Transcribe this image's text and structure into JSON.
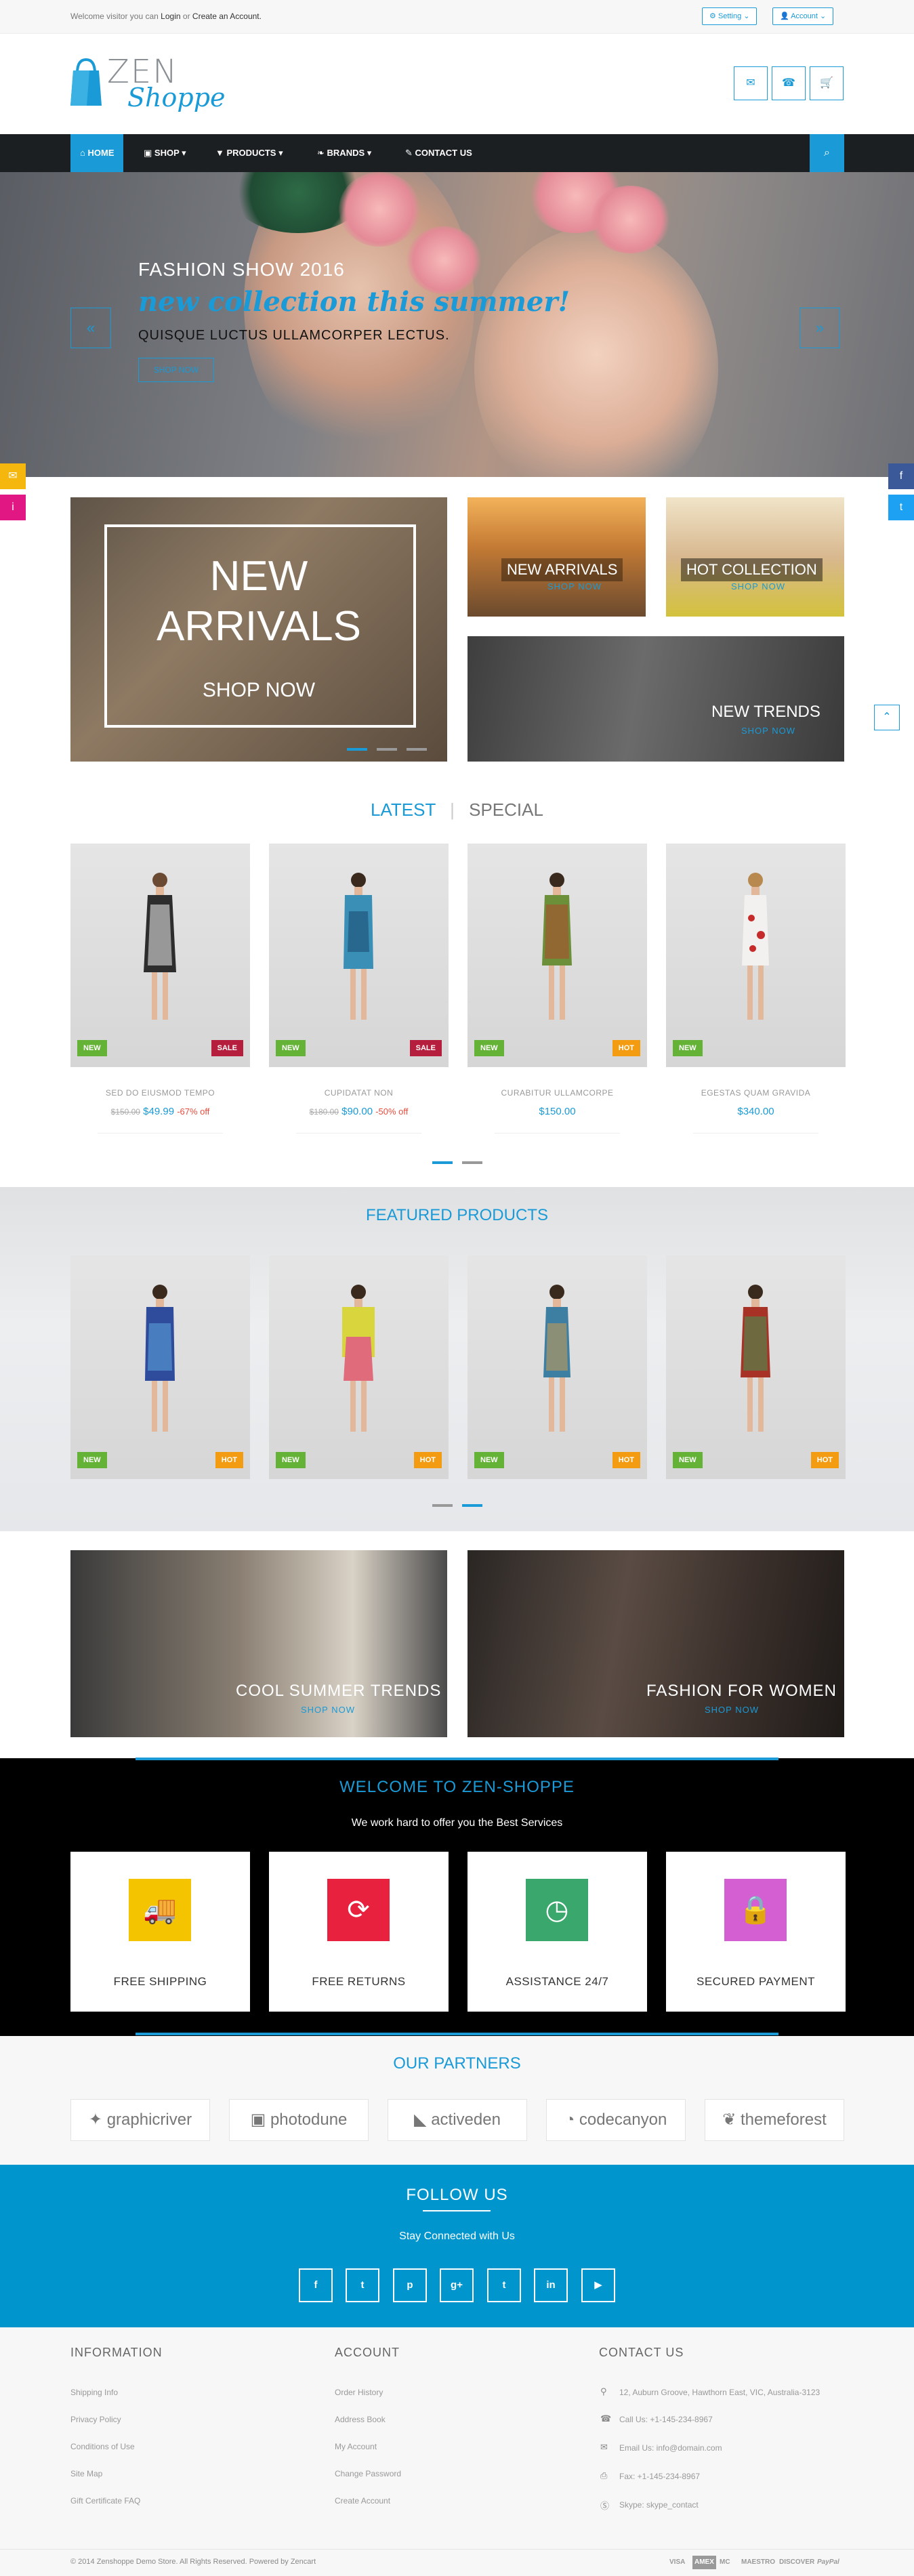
{
  "topbar": {
    "welcome_prefix": "Welcome visitor you can",
    "login": "Login",
    "or": "or",
    "create_account": "Create an Account.",
    "setting": "Setting",
    "account": "Account"
  },
  "logo": {
    "line1": "ZEN",
    "line2": "Shoppe"
  },
  "nav": {
    "items": [
      "HOME",
      "SHOP",
      "PRODUCTS",
      "BRANDS",
      "CONTACT US"
    ]
  },
  "hero": {
    "title": "FASHION SHOW 2016",
    "subtitle": "new collection this summer!",
    "description": "QUISQUE LUCTUS ULLAMCORPER LECTUS.",
    "button": "SHOP NOW"
  },
  "banners": {
    "main_line1": "NEW",
    "main_line2": "ARRIVALS",
    "main_shop": "SHOP NOW",
    "b1_title": "NEW ARRIVALS",
    "b1_shop": "SHOP NOW",
    "b2_title": "HOT COLLECTION",
    "b2_shop": "SHOP NOW",
    "b3_title": "NEW TRENDS",
    "b3_shop": "SHOP NOW"
  },
  "tabs": {
    "latest": "LATEST",
    "special": "SPECIAL"
  },
  "latest_products": [
    {
      "name": "SED DO EIUSMOD TEMPO",
      "old_price": "$150.00",
      "price": "$49.99",
      "discount": "-67% off",
      "badge_left": "NEW",
      "badge_right": "SALE"
    },
    {
      "name": "CUPIDATAT NON",
      "old_price": "$180.00",
      "price": "$90.00",
      "discount": "-50% off",
      "badge_left": "NEW",
      "badge_right": "SALE"
    },
    {
      "name": "CURABITUR ULLAMCORPE",
      "old_price": "",
      "price": "$150.00",
      "discount": "",
      "badge_left": "NEW",
      "badge_right": "HOT"
    },
    {
      "name": "EGESTAS QUAM GRAVIDA",
      "old_price": "",
      "price": "$340.00",
      "discount": "",
      "badge_left": "NEW",
      "badge_right": ""
    }
  ],
  "featured": {
    "title": "FEATURED PRODUCTS",
    "badges": [
      [
        "NEW",
        "HOT"
      ],
      [
        "NEW",
        "HOT"
      ],
      [
        "NEW",
        "HOT"
      ],
      [
        "NEW",
        "HOT"
      ]
    ]
  },
  "promos": {
    "p1_title": "COOL SUMMER TRENDS",
    "p1_shop": "SHOP NOW",
    "p2_title": "FASHION FOR WOMEN",
    "p2_shop": "SHOP NOW"
  },
  "welcome": {
    "title": "WELCOME TO ZEN-SHOPPE",
    "subtitle": "We work hard to offer you the Best Services",
    "services": [
      "FREE SHIPPING",
      "FREE RETURNS",
      "ASSISTANCE 24/7",
      "SECURED PAYMENT"
    ]
  },
  "partners": {
    "title": "OUR PARTNERS",
    "items": [
      "graphicriver",
      "photodune",
      "activeden",
      "codecanyon",
      "themeforest"
    ]
  },
  "follow": {
    "title": "FOLLOW US",
    "subtitle": "Stay Connected with Us",
    "icons": [
      "f",
      "t",
      "p",
      "g+",
      "t",
      "in",
      "yt"
    ]
  },
  "footer": {
    "information_title": "INFORMATION",
    "information": [
      "Shipping Info",
      "Privacy Policy",
      "Conditions of Use",
      "Site Map",
      "Gift Certificate FAQ"
    ],
    "account_title": "ACCOUNT",
    "account": [
      "Order History",
      "Address Book",
      "My Account",
      "Change Password",
      "Create Account"
    ],
    "contact_title": "CONTACT US",
    "contact": [
      "12, Auburn Groove, Hawthorn East, VIC, Australia-3123",
      "Call Us: +1-145-234-8967",
      "Email Us: info@domain.com",
      "Fax: +1-145-234-8967",
      "Skype: skype_contact"
    ],
    "copyright": "© 2014 Zenshoppe Demo Store. All Rights Reserved. Powered by Zencart",
    "payments": [
      "VISA",
      "AMEX",
      "MC",
      "MAESTRO",
      "DISCOVER",
      "PayPal"
    ]
  },
  "colors": {
    "accent": "#1a9ad6",
    "nav_bg": "#1c1f22",
    "new_badge": "#64b336",
    "sale_badge": "#b51e3c",
    "hot_badge": "#f39c12",
    "follow_bg": "#0195ce",
    "shipping": "#f5c400",
    "returns": "#e8213f",
    "assistance": "#3aa76d",
    "payment": "#d35fd3"
  }
}
